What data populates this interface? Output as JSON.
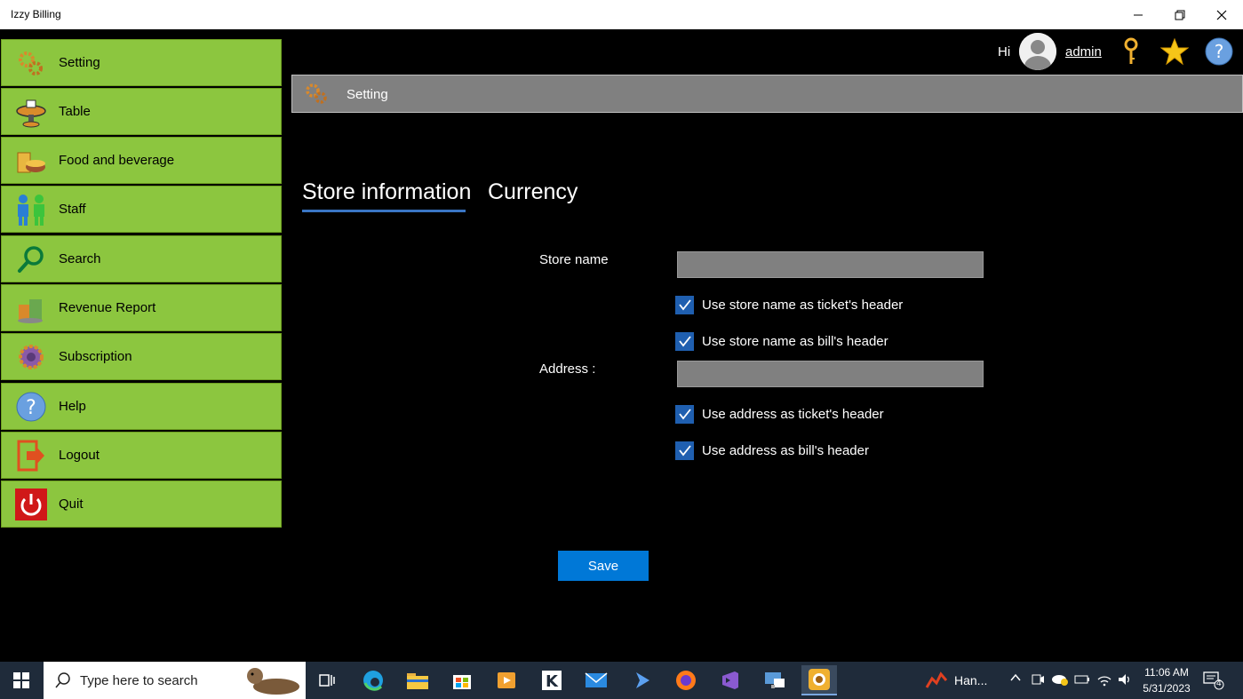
{
  "window": {
    "title": "Izzy Billing"
  },
  "sidebar": {
    "items": [
      {
        "label": "Setting",
        "icon": "gears-icon"
      },
      {
        "label": "Table",
        "icon": "table-icon"
      },
      {
        "label": "Food and beverage",
        "icon": "food-icon"
      },
      {
        "label": "Staff",
        "icon": "staff-icon"
      },
      {
        "label": "Search",
        "icon": "search-icon"
      },
      {
        "label": "Revenue Report",
        "icon": "report-icon"
      },
      {
        "label": "Subscription",
        "icon": "subscription-icon"
      },
      {
        "label": "Help",
        "icon": "help-icon"
      },
      {
        "label": "Logout",
        "icon": "logout-icon"
      },
      {
        "label": "Quit",
        "icon": "power-icon"
      }
    ]
  },
  "user": {
    "greeting": "Hi",
    "name": "admin"
  },
  "header": {
    "title": "Setting"
  },
  "tabs": [
    {
      "label": "Store information",
      "selected": true
    },
    {
      "label": "Currency",
      "selected": false
    }
  ],
  "form": {
    "store_name_label": "Store name",
    "store_name_value": "",
    "store_name_ticket": {
      "label": "Use store name as ticket's header",
      "checked": true
    },
    "store_name_bill": {
      "label": "Use store name as bill's header",
      "checked": true
    },
    "address_label": "Address :",
    "address_value": "",
    "address_ticket": {
      "label": "Use address as ticket's header",
      "checked": true
    },
    "address_bill": {
      "label": "Use address as bill's header",
      "checked": true
    },
    "save_label": "Save"
  },
  "taskbar": {
    "search_placeholder": "Type here to search",
    "tray_app_label": "Han...",
    "time": "11:06 AM",
    "date": "5/31/2023",
    "notification_count": "4"
  },
  "colors": {
    "sidebar_bg": "#8cc63f",
    "header_bg": "#808080",
    "accent": "#0078d7",
    "checkbox": "#1f5fb0"
  }
}
